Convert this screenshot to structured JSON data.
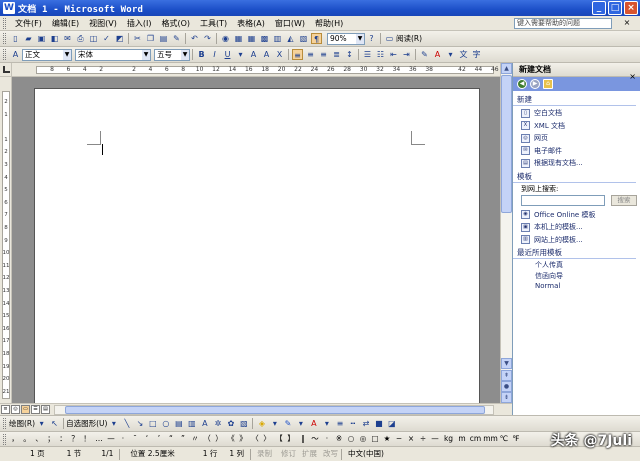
{
  "window": {
    "title": "文档 1 - Microsoft Word",
    "app_icon": "W"
  },
  "menubar": {
    "items": [
      "文件(F)",
      "编辑(E)",
      "视图(V)",
      "插入(I)",
      "格式(O)",
      "工具(T)",
      "表格(A)",
      "窗口(W)",
      "帮助(H)"
    ],
    "help_placeholder": "键入需要帮助的问题"
  },
  "standard_toolbar": {
    "zoom": "90%",
    "read_label": "阅读(R)"
  },
  "formatting_toolbar": {
    "style": "正文",
    "font": "宋体",
    "size": "五号",
    "bold": "B",
    "italic": "I",
    "underline": "U",
    "font_color_glyph": "A"
  },
  "ruler": {
    "h_ticks": [
      "8",
      "6",
      "4",
      "2",
      "",
      "2",
      "4",
      "6",
      "8",
      "10",
      "12",
      "14",
      "16",
      "18",
      "20",
      "22",
      "24",
      "26",
      "28",
      "30",
      "32",
      "34",
      "36",
      "38",
      "",
      "42",
      "44",
      "46",
      "48"
    ],
    "v_ticks": [
      "2",
      "1",
      "",
      "1",
      "2",
      "3",
      "4",
      "5",
      "6",
      "7",
      "8",
      "9",
      "10",
      "11",
      "12",
      "13",
      "14",
      "15",
      "16",
      "17",
      "18",
      "19",
      "20",
      "21"
    ]
  },
  "task_pane": {
    "title": "新建文档",
    "new_section": "新建",
    "new_items": [
      {
        "icon": "blank-doc-icon",
        "label": "空白文档"
      },
      {
        "icon": "xml-doc-icon",
        "label": "XML 文档"
      },
      {
        "icon": "web-page-icon",
        "label": "网页"
      },
      {
        "icon": "email-icon",
        "label": "电子邮件"
      },
      {
        "icon": "from-existing-icon",
        "label": "根据现有文档..."
      }
    ],
    "templates_section": "模板",
    "search_label": "到网上搜索:",
    "search_button": "搜索",
    "template_items": [
      {
        "icon": "office-online-icon",
        "label": "Office Online 模板"
      },
      {
        "icon": "local-templates-icon",
        "label": "本机上的模板..."
      },
      {
        "icon": "website-templates-icon",
        "label": "网站上的模板..."
      }
    ],
    "recent_section": "最近所用模板",
    "recent_items": [
      "个人传真",
      "信函向导",
      "Normal"
    ]
  },
  "drawing_toolbar": {
    "draw_label": "绘图(R)",
    "autoshapes_label": "自选图形(U)"
  },
  "symbol_toolbar": {
    "symbols": [
      "，",
      "。",
      "、",
      "；",
      "：",
      "？",
      "！",
      "…",
      "—",
      "·",
      "ˉ",
      "‘",
      "’",
      "“",
      "”",
      "〃",
      "（",
      "）",
      "《",
      "》",
      "〈",
      "〉",
      "【",
      "】",
      "‖",
      "～",
      "·",
      "※",
      "○",
      "◎",
      "□",
      "★",
      "−",
      "×",
      "÷",
      "—",
      "kg",
      "m",
      "cm",
      "mm",
      "℃",
      "℉"
    ]
  },
  "statusbar": {
    "page": "1 页",
    "section": "1 节",
    "page_of": "1/1",
    "position": "位置 2.5厘米",
    "line": "1 行",
    "column": "1 列",
    "rec": "录制",
    "trk": "修订",
    "ext": "扩展",
    "ovr": "改写",
    "language": "中文(中国)"
  },
  "watermark": {
    "text": "头条 @7Juli"
  }
}
